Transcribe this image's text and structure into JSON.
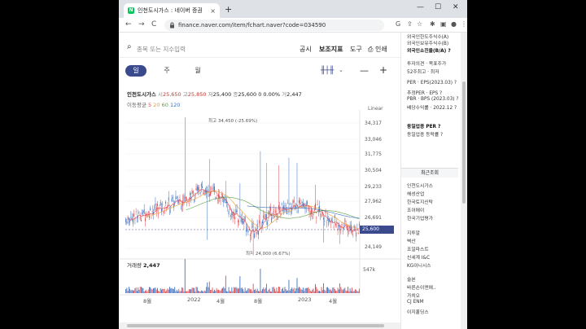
{
  "browser": {
    "tab_title": "인천도시가스 : 네이버 증권",
    "tab_close": "×",
    "new_tab": "+",
    "url": "finance.naver.com/item/fchart.naver?code=034590",
    "back": "←",
    "forward": "→",
    "reload": "C",
    "minimize": "—",
    "maximize": "☐",
    "close": "✕",
    "more": "⋮"
  },
  "toolbar": {
    "search_placeholder": "종목 또는 지수입력",
    "menu_notice": "공시",
    "menu_indicator": "보조지표",
    "menu_tools": "도구",
    "menu_print": "인쇄"
  },
  "periods": [
    "일",
    "주",
    "월"
  ],
  "active_period": 0,
  "ticker": {
    "name": "인천도시가스",
    "open_label": "시",
    "open": "25,650",
    "high_label": "고",
    "high": "25,850",
    "low_label": "저",
    "low": "25,400",
    "close_label": "종",
    "close": "25,600",
    "change": "0 0.00%",
    "vol_label": "거",
    "volume": "2,447"
  },
  "ma": {
    "label": "이동평균",
    "p5": "5",
    "p20": "20",
    "p60": "60",
    "p120": "120",
    "c5": "#e0484c",
    "c20": "#f0a030",
    "c60": "#5aa040",
    "c120": "#3a6fc0"
  },
  "scale_label": "Linear",
  "chart_data": {
    "type": "candlestick",
    "yticks": [
      "34,317",
      "33,046",
      "31,775",
      "30,504",
      "29,233",
      "27,962",
      "26,691",
      "25,600",
      "24,149"
    ],
    "ylim": [
      23800,
      34700
    ],
    "xticks": [
      "8월",
      "2022",
      "4월",
      "8월",
      "2023",
      "4월"
    ],
    "max_annotation": "최고 34,450 (-25.69%)",
    "min_annotation": "최저 24,000 (6.67%)",
    "current_price": "25,600",
    "volume_label": "거래량",
    "volume_value": "2,447",
    "volume_max": "547k",
    "colors": {
      "up": "#e0484c",
      "down": "#3a6fc0"
    }
  },
  "right_panel": {
    "rows": [
      {
        "text": "외국인한도주식수(A)",
        "bold": false
      },
      {
        "text": "외국인보유주식수(B)",
        "bold": false
      },
      {
        "text": "외국인소진율(B/A) ?",
        "bold": true
      },
      {
        "text": "투자의견 · 목표주가",
        "bold": false
      },
      {
        "text": "52주최고 · 최저",
        "bold": false
      },
      {
        "text": "PER · EPS(2023.03) ?",
        "bold": false
      },
      {
        "text": "추정PER · EPS ?",
        "bold": false
      },
      {
        "text": "PBR · BPS (2023.03) ?",
        "bold": false
      },
      {
        "text": "배당수익률 · 2022.12 ?",
        "bold": false
      },
      {
        "text": "동일업종 PER ?",
        "bold": true
      },
      {
        "text": "동일업종 등락률 ?",
        "bold": false
      }
    ],
    "recent_header": "최근조회",
    "recent": [
      "인천도시가스",
      "해성산업",
      "한국토지신탁",
      "조이에이",
      "한국기업평가",
      "지투알",
      "벽산",
      "조일파스트",
      "신세계 I&C",
      "KG이니시스",
      "솔본",
      "바른손이앤에..",
      "가치오",
      "CJ ENM",
      "이지홀딩스"
    ]
  }
}
